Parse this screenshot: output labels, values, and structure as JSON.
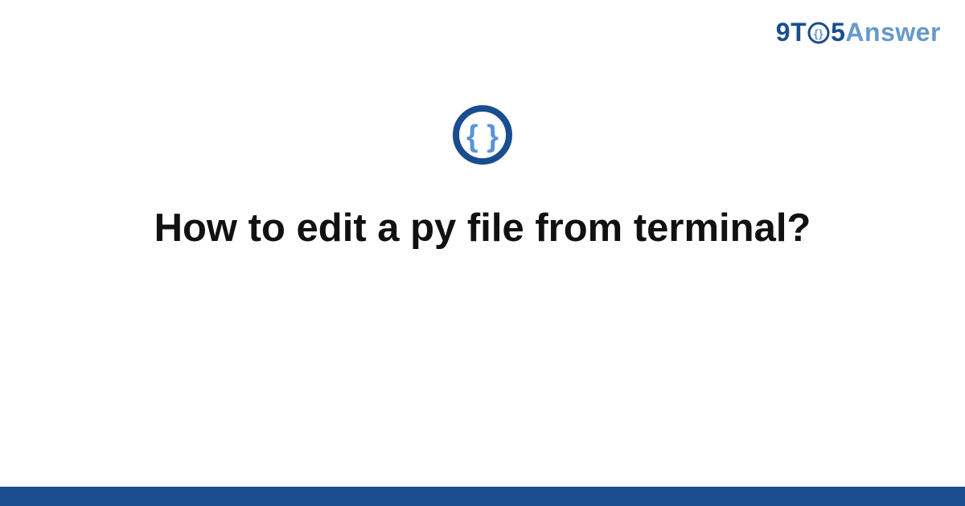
{
  "brand": {
    "part1": "9T",
    "part3": "5",
    "part4": "Answer"
  },
  "hero": {
    "title": "How to edit a py file from terminal?"
  },
  "colors": {
    "brand_dark": "#1a4d8f",
    "brand_light": "#6699cc"
  }
}
